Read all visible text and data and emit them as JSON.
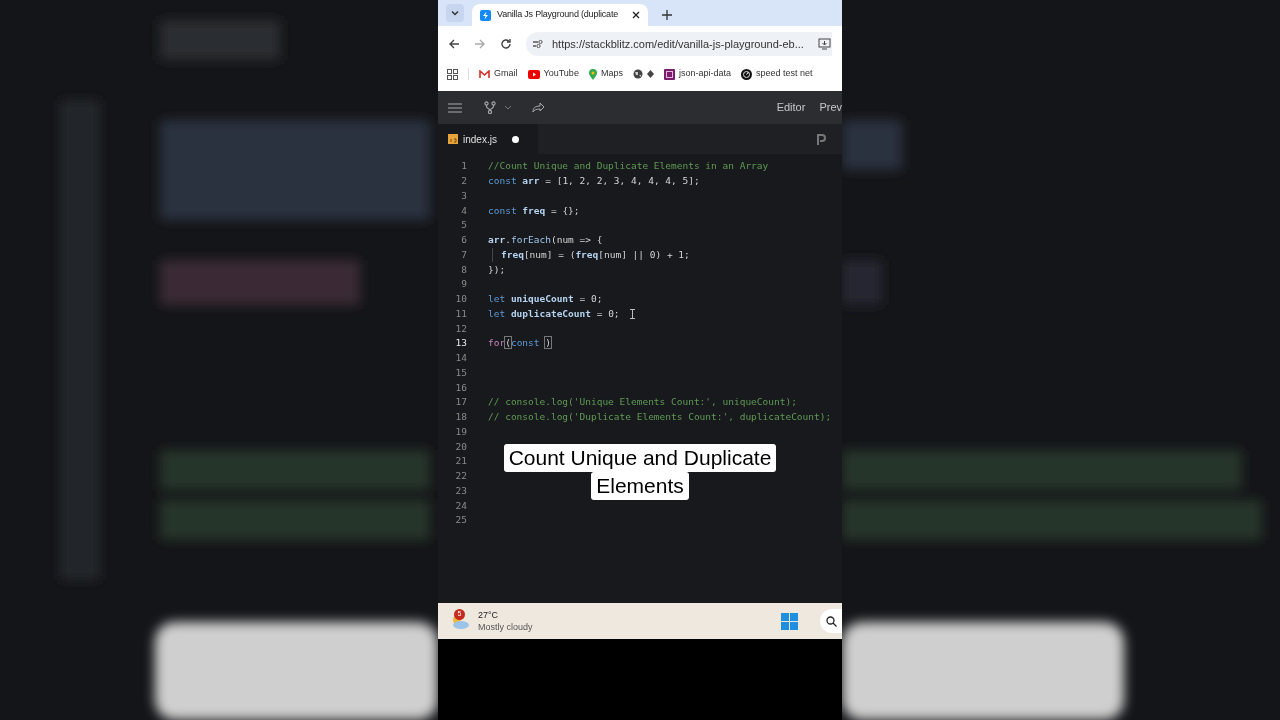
{
  "browser": {
    "tabs": [
      {
        "title": "Vanilla Js Playground (duplicate",
        "selected": true
      }
    ],
    "url": "https://stackblitz.com/edit/vanilla-js-playground-eb...",
    "bookmarks": [
      {
        "kind": "gmail",
        "label": "Gmail"
      },
      {
        "kind": "youtube",
        "label": "YouTube"
      },
      {
        "kind": "maps",
        "label": "Maps"
      },
      {
        "kind": "globe"
      },
      {
        "kind": "app",
        "label": "json-api-data"
      },
      {
        "kind": "speed",
        "label": "speed test net"
      }
    ]
  },
  "toolbar": {
    "links": [
      "Editor",
      "Prev"
    ]
  },
  "editor": {
    "tabs": [
      {
        "label": "index.js",
        "selected": true,
        "modified": true
      }
    ],
    "lines": [
      {
        "number": "1",
        "tokens": [
          {
            "kind": "comment",
            "text": "//Count Unique and Duplicate Elements in an Array"
          }
        ]
      },
      {
        "number": "2",
        "tokens": [
          {
            "kind": "keyword",
            "text": "const "
          },
          {
            "kind": "variable",
            "text": "arr"
          },
          {
            "kind": "plain",
            "text": " = [1, 2, 2, 3, 4, 4, 4, 5];"
          }
        ]
      },
      {
        "number": "3"
      },
      {
        "number": "4",
        "tokens": [
          {
            "kind": "keyword",
            "text": "const "
          },
          {
            "kind": "variable",
            "text": "freq"
          },
          {
            "kind": "plain",
            "text": " = {};"
          }
        ]
      },
      {
        "number": "5"
      },
      {
        "number": "6",
        "tokens": [
          {
            "kind": "variable",
            "text": "arr"
          },
          {
            "kind": "plain",
            "text": "."
          },
          {
            "kind": "function",
            "text": "forEach"
          },
          {
            "kind": "plain",
            "text": "(num => {"
          }
        ]
      },
      {
        "number": "7",
        "indent": true,
        "tokens": [
          {
            "kind": "variable",
            "text": "freq"
          },
          {
            "kind": "plain",
            "text": "[num] = ("
          },
          {
            "kind": "variable",
            "text": "freq"
          },
          {
            "kind": "plain",
            "text": "[num] || 0) + 1;"
          }
        ]
      },
      {
        "number": "8",
        "tokens": [
          {
            "kind": "plain",
            "text": "});"
          }
        ]
      },
      {
        "number": "9"
      },
      {
        "number": "10",
        "tokens": [
          {
            "kind": "keyword",
            "text": "let "
          },
          {
            "kind": "variable",
            "text": "uniqueCount"
          },
          {
            "kind": "plain",
            "text": " = 0;"
          }
        ]
      },
      {
        "number": "11",
        "tokens": [
          {
            "kind": "keyword",
            "text": "let "
          },
          {
            "kind": "variable",
            "text": "duplicateCount"
          },
          {
            "kind": "plain",
            "text": " = 0;"
          }
        ],
        "pointer": true
      },
      {
        "number": "12"
      },
      {
        "number": "13",
        "tokens": [
          {
            "kind": "control",
            "text": "for"
          },
          {
            "kind": "bracket",
            "text": "("
          },
          {
            "kind": "keyword",
            "text": "const "
          },
          {
            "kind": "bracket",
            "text": ")"
          }
        ],
        "current": true
      },
      {
        "number": "14"
      },
      {
        "number": "15"
      },
      {
        "number": "16"
      },
      {
        "number": "17",
        "tokens": [
          {
            "kind": "comment",
            "text": "// console.log('Unique Elements Count:', uniqueCount);"
          }
        ]
      },
      {
        "number": "18",
        "tokens": [
          {
            "kind": "comment",
            "text": "// console.log('Duplicate Elements Count:', duplicateCount);"
          }
        ]
      },
      {
        "number": "19"
      },
      {
        "number": "20"
      },
      {
        "number": "21"
      },
      {
        "number": "22"
      },
      {
        "number": "23"
      },
      {
        "number": "24"
      },
      {
        "number": "25"
      }
    ]
  },
  "caption": [
    "Count Unique and Duplicate",
    "Elements"
  ],
  "taskbar": {
    "weather": {
      "badge": "5",
      "temperature": "27°C",
      "condition": "Mostly cloudy"
    }
  }
}
